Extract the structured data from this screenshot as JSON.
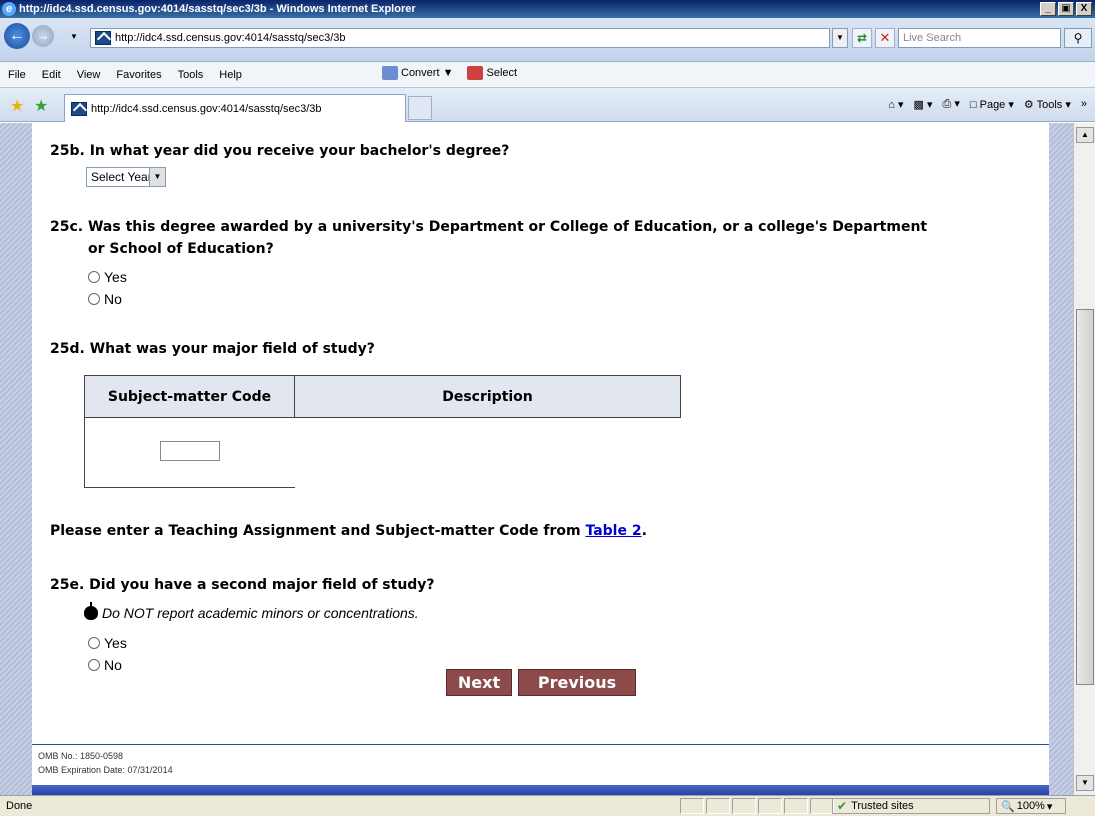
{
  "window": {
    "title": "http://idc4.ssd.census.gov:4014/sasstq/sec3/3b - Windows Internet Explorer",
    "minimize": "_",
    "maximize": "▣",
    "close": "X"
  },
  "address": {
    "url": "http://idc4.ssd.census.gov:4014/sasstq/sec3/3b",
    "search_placeholder": "Live Search"
  },
  "menu": {
    "items": [
      "File",
      "Edit",
      "View",
      "Favorites",
      "Tools",
      "Help"
    ],
    "convert": "Convert",
    "select": "Select"
  },
  "tab": {
    "title": "http://idc4.ssd.census.gov:4014/sasstq/sec3/3b"
  },
  "commandbar": {
    "page": "Page",
    "tools": "Tools"
  },
  "form": {
    "q25b": "25b. In what year did you receive your bachelor's degree?",
    "year_select": "Select Year",
    "q25c_line1": "25c. Was this degree awarded by a university's Department or College of Education, or a college's Department",
    "q25c_line2": "or School of Education?",
    "yes": "Yes",
    "no": "No",
    "q25d": "25d. What was your major field of study?",
    "col_code": "Subject-matter Code",
    "col_desc": "Description",
    "table_note_prefix": "Please enter a Teaching Assignment and Subject-matter Code from ",
    "table_link": "Table 2",
    "table_note_suffix": ".",
    "q25e": "25e. Did you have a second major field of study?",
    "note": "Do NOT report academic minors or concentrations.",
    "next": "Next",
    "previous": "Previous",
    "omb_no": "OMB No.: 1850-0598",
    "omb_exp": "OMB Expiration Date: 07/31/2014"
  },
  "status": {
    "text": "Done",
    "zone": "Trusted sites",
    "zoom": "100%"
  }
}
